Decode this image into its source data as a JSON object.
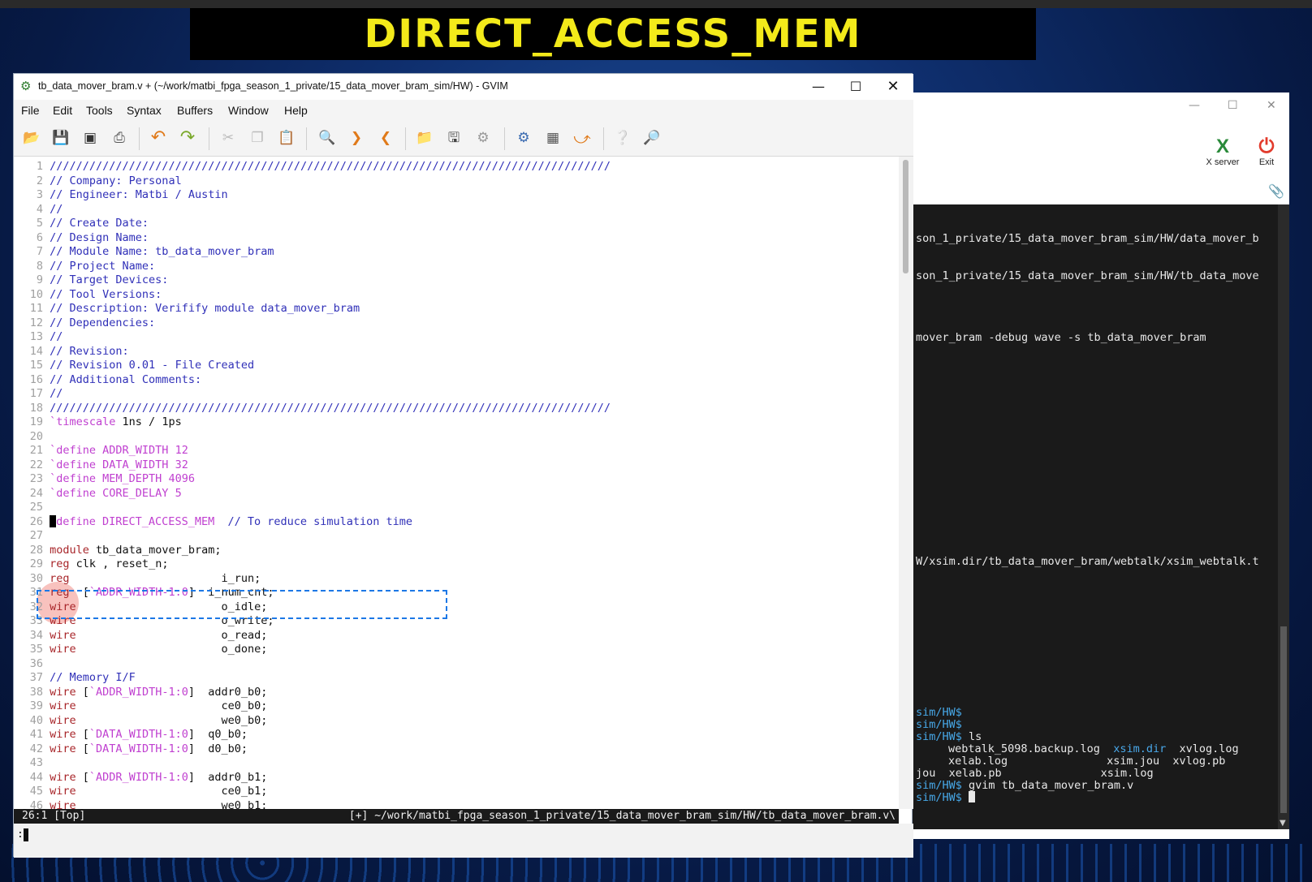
{
  "banner": {
    "text": "DIRECT_ACCESS_MEM"
  },
  "gvim": {
    "title": "tb_data_mover_bram.v + (~/work/matbi_fpga_season_1_private/15_data_mover_bram_sim/HW) - GVIM",
    "menus": [
      "File",
      "Edit",
      "Tools",
      "Syntax",
      "Buffers",
      "Window",
      "Help"
    ],
    "status_left": "26:1 [Top]",
    "status_right": "[+] ~/work/matbi_fpga_season_1_private/15_data_mover_bram_sim/HW/tb_data_mover_bram.v\\",
    "cmdline": ":"
  },
  "toolbar_icons": [
    "open-icon",
    "save-icon",
    "save-all-icon",
    "print-icon",
    "undo-icon",
    "redo-icon",
    "cut-icon",
    "copy-icon",
    "paste-icon",
    "find-replace-icon",
    "find-next-icon",
    "find-prev-icon",
    "load-session-icon",
    "save-session-icon",
    "run-script-icon",
    "make-icon",
    "run-ctags-icon",
    "jump-tag-icon",
    "help-icon",
    "find-help-icon"
  ],
  "code": [
    {
      "n": "1",
      "parts": [
        [
          "c",
          "/////////////////////////////////////////////////////////////////////////////////////"
        ]
      ]
    },
    {
      "n": "2",
      "parts": [
        [
          "c",
          "// Company: Personal"
        ]
      ]
    },
    {
      "n": "3",
      "parts": [
        [
          "c",
          "// Engineer: Matbi / Austin"
        ]
      ]
    },
    {
      "n": "4",
      "parts": [
        [
          "c",
          "//"
        ]
      ]
    },
    {
      "n": "5",
      "parts": [
        [
          "c",
          "// Create Date:"
        ]
      ]
    },
    {
      "n": "6",
      "parts": [
        [
          "c",
          "// Design Name:"
        ]
      ]
    },
    {
      "n": "7",
      "parts": [
        [
          "c",
          "// Module Name: tb_data_mover_bram"
        ]
      ]
    },
    {
      "n": "8",
      "parts": [
        [
          "c",
          "// Project Name:"
        ]
      ]
    },
    {
      "n": "9",
      "parts": [
        [
          "c",
          "// Target Devices:"
        ]
      ]
    },
    {
      "n": "10",
      "parts": [
        [
          "c",
          "// Tool Versions:"
        ]
      ]
    },
    {
      "n": "11",
      "parts": [
        [
          "c",
          "// Description: Verifify module data_mover_bram"
        ]
      ]
    },
    {
      "n": "12",
      "parts": [
        [
          "c",
          "// Dependencies:"
        ]
      ]
    },
    {
      "n": "13",
      "parts": [
        [
          "c",
          "//"
        ]
      ]
    },
    {
      "n": "14",
      "parts": [
        [
          "c",
          "// Revision:"
        ]
      ]
    },
    {
      "n": "15",
      "parts": [
        [
          "c",
          "// Revision 0.01 - File Created"
        ]
      ]
    },
    {
      "n": "16",
      "parts": [
        [
          "c",
          "// Additional Comments:"
        ]
      ]
    },
    {
      "n": "17",
      "parts": [
        [
          "c",
          "//"
        ]
      ]
    },
    {
      "n": "18",
      "parts": [
        [
          "c",
          "/////////////////////////////////////////////////////////////////////////////////////"
        ]
      ]
    },
    {
      "n": "19",
      "parts": [
        [
          "d",
          "`timescale"
        ],
        [
          "tx",
          " 1ns / 1ps"
        ]
      ]
    },
    {
      "n": "20",
      "parts": []
    },
    {
      "n": "21",
      "parts": [
        [
          "d",
          "`define ADDR_WIDTH 12"
        ]
      ]
    },
    {
      "n": "22",
      "parts": [
        [
          "d",
          "`define DATA_WIDTH 32"
        ]
      ]
    },
    {
      "n": "23",
      "parts": [
        [
          "d",
          "`define MEM_DEPTH 4096"
        ]
      ]
    },
    {
      "n": "24",
      "parts": [
        [
          "d",
          "`define CORE_DELAY 5"
        ]
      ]
    },
    {
      "n": "25",
      "parts": []
    },
    {
      "n": "26",
      "cursor": true,
      "parts": [
        [
          "d",
          "define DIRECT_ACCESS_MEM"
        ],
        [
          "c",
          "  // To reduce simulation time"
        ]
      ]
    },
    {
      "n": "27",
      "parts": []
    },
    {
      "n": "28",
      "parts": [
        [
          "kw",
          "module"
        ],
        [
          "tx",
          " tb_data_mover_bram;"
        ]
      ]
    },
    {
      "n": "29",
      "parts": [
        [
          "kw",
          "reg"
        ],
        [
          "tx",
          " clk , reset_n;"
        ]
      ]
    },
    {
      "n": "30",
      "parts": [
        [
          "kw",
          "reg"
        ],
        [
          "tx",
          "                       i_run;"
        ]
      ]
    },
    {
      "n": "31",
      "parts": [
        [
          "kw",
          "reg"
        ],
        [
          "tx",
          "  ["
        ],
        [
          "d",
          "`ADDR_WIDTH-1:0"
        ],
        [
          "tx",
          "]  i_num_cnt;"
        ]
      ]
    },
    {
      "n": "32",
      "parts": [
        [
          "kw",
          "wire"
        ],
        [
          "tx",
          "                      o_idle;"
        ]
      ]
    },
    {
      "n": "33",
      "parts": [
        [
          "kw",
          "wire"
        ],
        [
          "tx",
          "                      o_write;"
        ]
      ]
    },
    {
      "n": "34",
      "parts": [
        [
          "kw",
          "wire"
        ],
        [
          "tx",
          "                      o_read;"
        ]
      ]
    },
    {
      "n": "35",
      "parts": [
        [
          "kw",
          "wire"
        ],
        [
          "tx",
          "                      o_done;"
        ]
      ]
    },
    {
      "n": "36",
      "parts": []
    },
    {
      "n": "37",
      "parts": [
        [
          "c",
          "// Memory I/F"
        ]
      ]
    },
    {
      "n": "38",
      "parts": [
        [
          "kw",
          "wire"
        ],
        [
          "tx",
          " ["
        ],
        [
          "d",
          "`ADDR_WIDTH-1:0"
        ],
        [
          "tx",
          "]  addr0_b0;"
        ]
      ]
    },
    {
      "n": "39",
      "parts": [
        [
          "kw",
          "wire"
        ],
        [
          "tx",
          "                      ce0_b0;"
        ]
      ]
    },
    {
      "n": "40",
      "parts": [
        [
          "kw",
          "wire"
        ],
        [
          "tx",
          "                      we0_b0;"
        ]
      ]
    },
    {
      "n": "41",
      "parts": [
        [
          "kw",
          "wire"
        ],
        [
          "tx",
          " ["
        ],
        [
          "d",
          "`DATA_WIDTH-1:0"
        ],
        [
          "tx",
          "]  q0_b0;"
        ]
      ]
    },
    {
      "n": "42",
      "parts": [
        [
          "kw",
          "wire"
        ],
        [
          "tx",
          " ["
        ],
        [
          "d",
          "`DATA_WIDTH-1:0"
        ],
        [
          "tx",
          "]  d0_b0;"
        ]
      ]
    },
    {
      "n": "43",
      "parts": []
    },
    {
      "n": "44",
      "parts": [
        [
          "kw",
          "wire"
        ],
        [
          "tx",
          " ["
        ],
        [
          "d",
          "`ADDR_WIDTH-1:0"
        ],
        [
          "tx",
          "]  addr0_b1;"
        ]
      ]
    },
    {
      "n": "45",
      "parts": [
        [
          "kw",
          "wire"
        ],
        [
          "tx",
          "                      ce0_b1;"
        ]
      ]
    },
    {
      "n": "46",
      "parts": [
        [
          "kw",
          "wire"
        ],
        [
          "tx",
          "                      we0_b1;"
        ]
      ]
    }
  ],
  "xserver": {
    "server_label": "X server",
    "exit_label": "Exit"
  },
  "terminal": {
    "lines": [
      "son_1_private/15_data_mover_bram_sim/HW/data_mover_b",
      "son_1_private/15_data_mover_bram_sim/HW/tb_data_move",
      "mover_bram -debug wave -s tb_data_mover_bram",
      "W/xsim.dir/tb_data_mover_bram/webtalk/xsim_webtalk.t"
    ],
    "prompt": "sim/HW$",
    "ls_cmd": " ls",
    "ls_row1": [
      "webtalk_5098.backup.log",
      "xsim.dir",
      "xvlog.log"
    ],
    "ls_row2": [
      "xelab.log",
      "xsim.jou",
      "xvlog.pb"
    ],
    "ls_row3": [
      "jou",
      "xelab.pb",
      "xsim.log"
    ],
    "gvim_cmd": " gvim tb_data_mover_bram.v"
  }
}
